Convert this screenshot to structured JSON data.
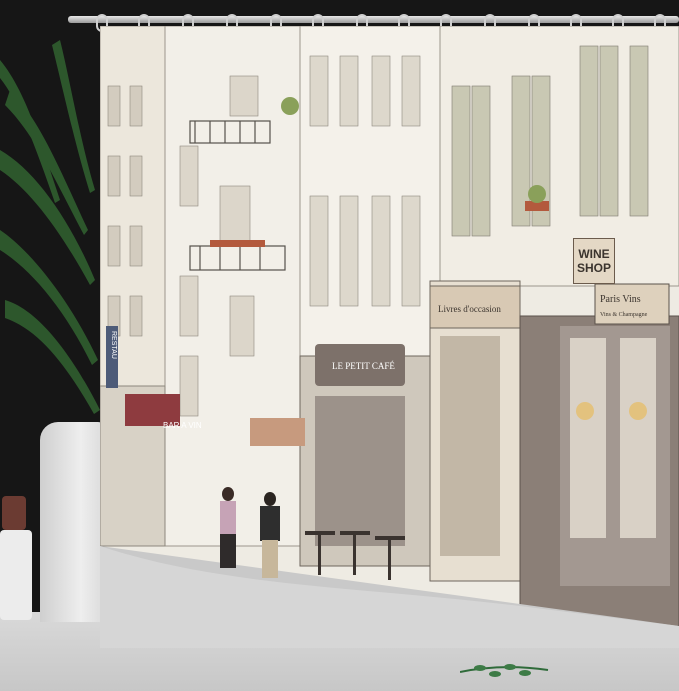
{
  "image": {
    "signs": {
      "wine_shop_line1": "WINE",
      "wine_shop_line2": "SHOP",
      "bookshop": "Livres d'occasion",
      "wine_bar": "BAR A VIN",
      "restaurant_vertical": "RESTAU",
      "cafe": "LE PETIT CAFÉ",
      "shop_script": "Paris Vins",
      "shop_script_sub": "Vins & Champagne"
    },
    "colors": {
      "background": "#161616",
      "curtain_base": "#eeebe3",
      "building_light": "#f4f1ea",
      "building_mid": "#d9d3c8",
      "shopfront": "#8b7f77",
      "sign_tan": "#d8c9b4",
      "awning_red": "#8e3b3f",
      "plant_green": "#2f5b2e",
      "floor": "#d0d0d0"
    }
  }
}
